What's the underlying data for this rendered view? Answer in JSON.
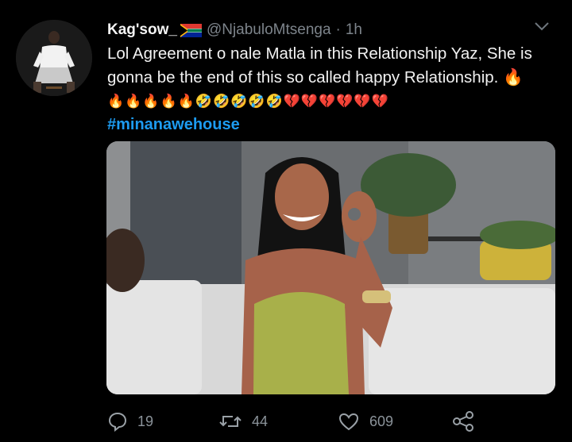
{
  "tweet": {
    "display_name": "Kag'sow_",
    "handle": "@NjabuloMtsenga",
    "separator": "·",
    "time": "1h",
    "text_line": "Lol Agreement o nale Matla in this Relationship Yaz, She is gonna be the end of this so called happy Relationship. 🔥",
    "emoji_line": "🔥🔥🔥🔥🔥🤣🤣🤣🤣🤣💔💔💔💔💔💔",
    "hashtag": "#minanawehouse"
  },
  "actions": {
    "reply_count": "19",
    "retweet_count": "44",
    "like_count": "609"
  },
  "colors": {
    "background": "#000000",
    "text": "#e7e9ea",
    "secondary": "#7d848b",
    "link": "#1d9bf0"
  },
  "icons": [
    "south-africa-flag-icon",
    "chevron-down-icon",
    "reply-icon",
    "retweet-icon",
    "like-icon",
    "share-icon"
  ]
}
